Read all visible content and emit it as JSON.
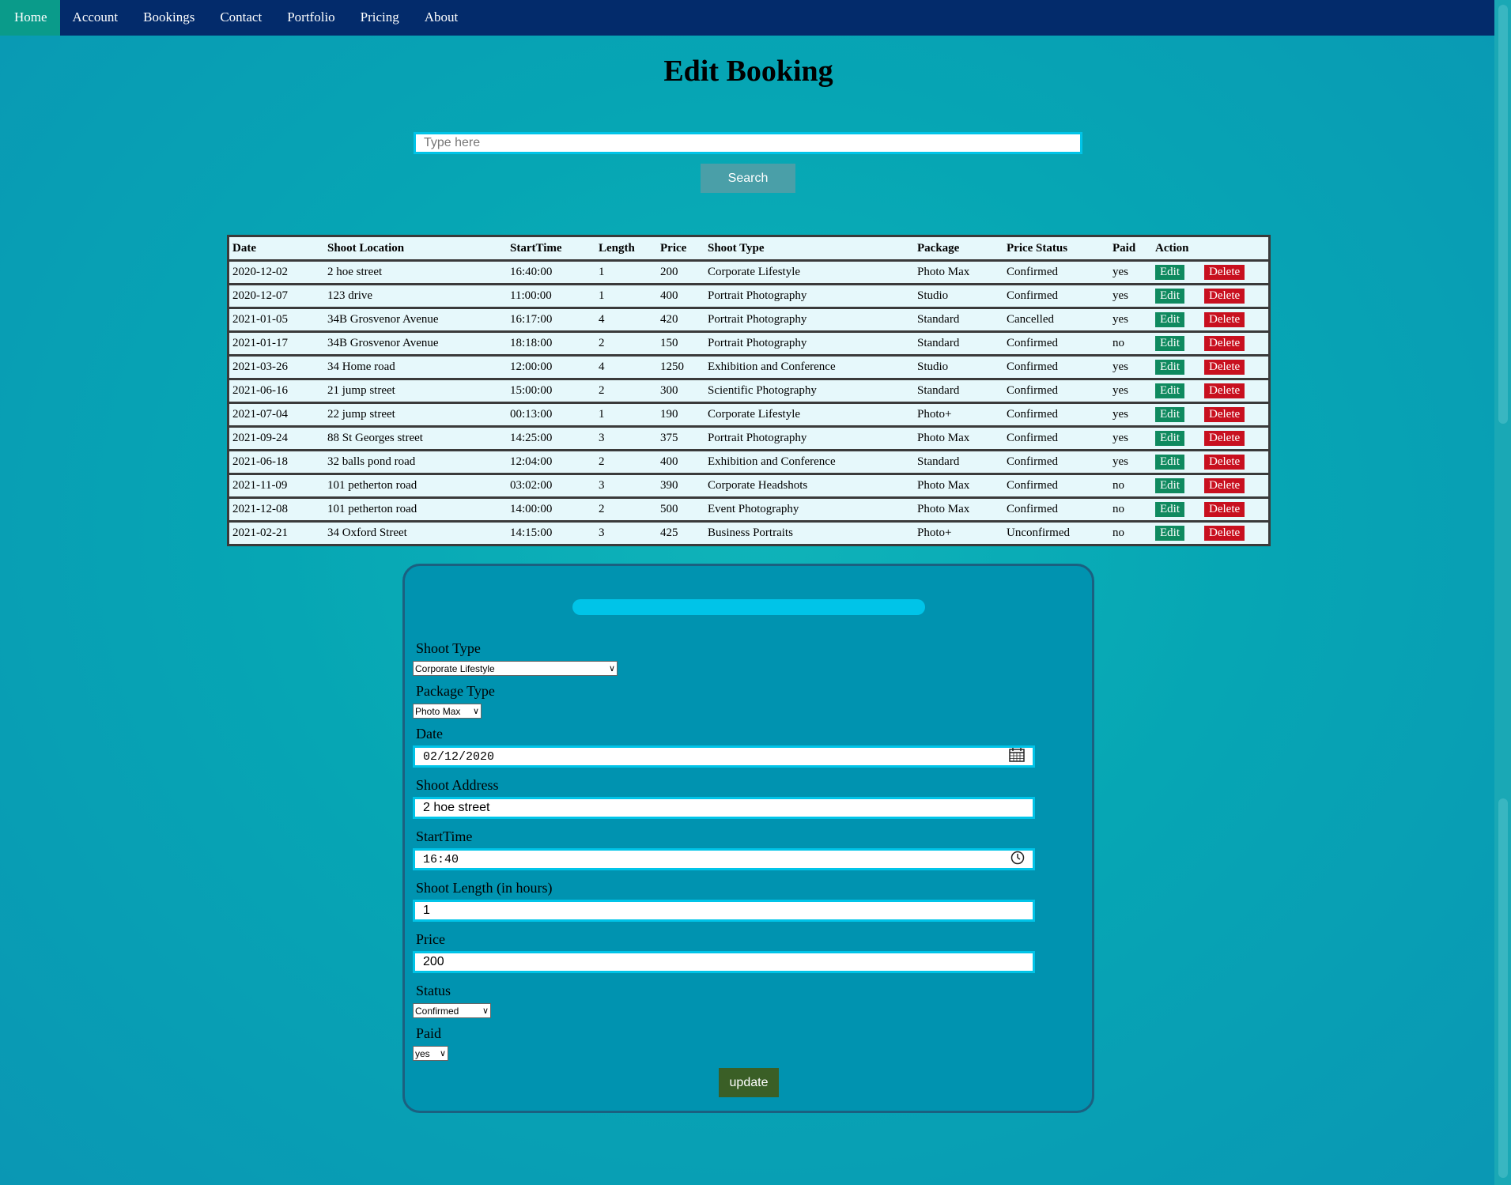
{
  "nav": {
    "items": [
      {
        "label": "Home",
        "active": true
      },
      {
        "label": "Account"
      },
      {
        "label": "Bookings"
      },
      {
        "label": "Contact"
      },
      {
        "label": "Portfolio"
      },
      {
        "label": "Pricing"
      },
      {
        "label": "About"
      }
    ]
  },
  "page": {
    "title": "Edit Booking"
  },
  "search": {
    "placeholder": "Type here",
    "button_label": "Search"
  },
  "table": {
    "headers": [
      "Date",
      "Shoot Location",
      "StartTime",
      "Length",
      "Price",
      "Shoot Type",
      "Package",
      "Price Status",
      "Paid",
      "Action",
      ""
    ],
    "edit_label": "Edit",
    "delete_label": "Delete",
    "rows": [
      [
        "2020-12-02",
        "2 hoe street",
        "16:40:00",
        "1",
        "200",
        "Corporate Lifestyle",
        "Photo Max",
        "Confirmed",
        "yes"
      ],
      [
        "2020-12-07",
        "123 drive",
        "11:00:00",
        "1",
        "400",
        "Portrait Photography",
        "Studio",
        "Confirmed",
        "yes"
      ],
      [
        "2021-01-05",
        "34B Grosvenor Avenue",
        "16:17:00",
        "4",
        "420",
        "Portrait Photography",
        "Standard",
        "Cancelled",
        "yes"
      ],
      [
        "2021-01-17",
        "34B Grosvenor Avenue",
        "18:18:00",
        "2",
        "150",
        "Portrait Photography",
        "Standard",
        "Confirmed",
        "no"
      ],
      [
        "2021-03-26",
        "34 Home road",
        "12:00:00",
        "4",
        "1250",
        "Exhibition and Conference",
        "Studio",
        "Confirmed",
        "yes"
      ],
      [
        "2021-06-16",
        "21 jump street",
        "15:00:00",
        "2",
        "300",
        "Scientific Photography",
        "Standard",
        "Confirmed",
        "yes"
      ],
      [
        "2021-07-04",
        "22 jump street",
        "00:13:00",
        "1",
        "190",
        "Corporate Lifestyle",
        "Photo+",
        "Confirmed",
        "yes"
      ],
      [
        "2021-09-24",
        "88 St Georges street",
        "14:25:00",
        "3",
        "375",
        "Portrait Photography",
        "Photo Max",
        "Confirmed",
        "yes"
      ],
      [
        "2021-06-18",
        "32 balls pond road",
        "12:04:00",
        "2",
        "400",
        "Exhibition and Conference",
        "Standard",
        "Confirmed",
        "yes"
      ],
      [
        "2021-11-09",
        "101 petherton road",
        "03:02:00",
        "3",
        "390",
        "Corporate Headshots",
        "Photo Max",
        "Confirmed",
        "no"
      ],
      [
        "2021-12-08",
        "101 petherton road",
        "14:00:00",
        "2",
        "500",
        "Event Photography",
        "Photo Max",
        "Confirmed",
        "no"
      ],
      [
        "2021-02-21",
        "34 Oxford Street",
        "14:15:00",
        "3",
        "425",
        "Business Portraits",
        "Photo+",
        "Unconfirmed",
        "no"
      ]
    ]
  },
  "form": {
    "shoot_type": {
      "label": "Shoot Type",
      "value": "Corporate Lifestyle"
    },
    "package_type": {
      "label": "Package Type",
      "value": "Photo Max"
    },
    "date": {
      "label": "Date",
      "value": "02/12/2020"
    },
    "shoot_address": {
      "label": "Shoot Address",
      "value": "2 hoe street"
    },
    "start_time": {
      "label": "StartTime",
      "value": "16:40"
    },
    "shoot_length": {
      "label": "Shoot Length (in hours)",
      "value": "1"
    },
    "price": {
      "label": "Price",
      "value": "200"
    },
    "status": {
      "label": "Status",
      "value": "Confirmed"
    },
    "paid": {
      "label": "Paid",
      "value": "yes"
    },
    "update_label": "update"
  },
  "colors": {
    "nav_bg": "#032b6b",
    "nav_active": "#0a9b8a",
    "edit": "#0f8a5f",
    "delete": "#c8101f",
    "input_border": "#00c4e8",
    "update": "#3a5f26"
  }
}
